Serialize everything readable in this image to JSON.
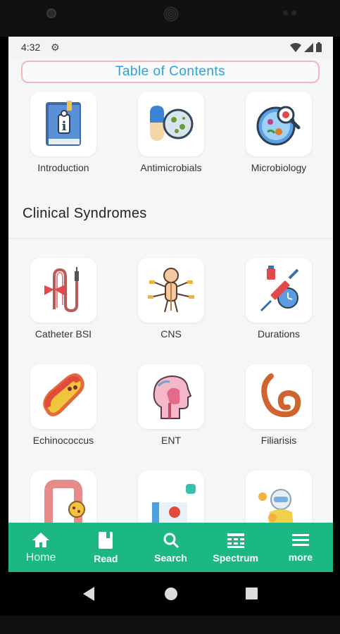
{
  "status": {
    "time": "4:32"
  },
  "header": {
    "title": "Table of Contents"
  },
  "top_items": [
    {
      "label": "Introduction",
      "icon": "book-info-icon"
    },
    {
      "label": "Antimicrobials",
      "icon": "pill-petri-icon"
    },
    {
      "label": "Microbiology",
      "icon": "petri-dish-magnifier-icon"
    }
  ],
  "section": {
    "title": "Clinical Syndromes"
  },
  "syndromes": [
    {
      "label": "Catheter BSI",
      "icon": "catheter-icon"
    },
    {
      "label": "CNS",
      "icon": "nervous-system-icon"
    },
    {
      "label": "Durations",
      "icon": "syringe-clock-icon"
    },
    {
      "label": "Echinococcus",
      "icon": "worm-icon"
    },
    {
      "label": "ENT",
      "icon": "head-profile-icon"
    },
    {
      "label": "Filiarisis",
      "icon": "filaria-worm-icon"
    }
  ],
  "nav": [
    {
      "label": "Home",
      "icon": "home-icon"
    },
    {
      "label": "Read",
      "icon": "book-icon"
    },
    {
      "label": "Search",
      "icon": "search-icon"
    },
    {
      "label": "Spectrum",
      "icon": "spectrum-icon"
    },
    {
      "label": "more",
      "icon": "menu-icon"
    }
  ],
  "colors": {
    "accent": "#1bb885",
    "header_text": "#2aa3d8",
    "header_border": "#f0b8b8"
  }
}
